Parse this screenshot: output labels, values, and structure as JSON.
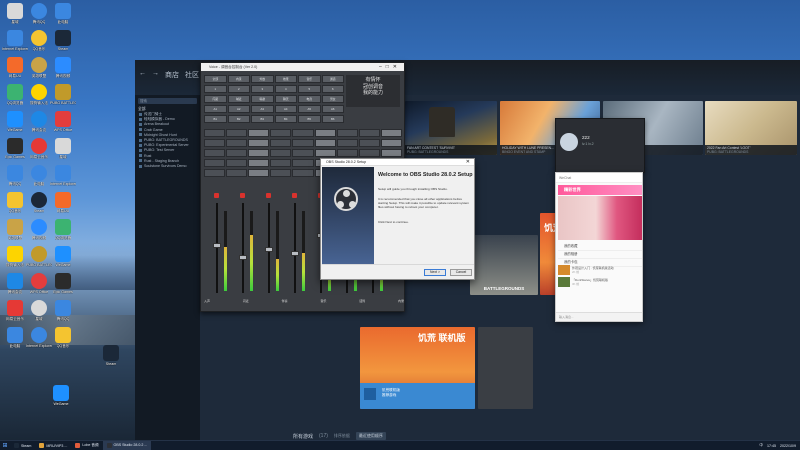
{
  "desktop": {
    "icons": [
      {
        "label": "星城",
        "color": "#d9d9d9"
      },
      {
        "label": "腾讯QQ",
        "color": "#3b87e0"
      },
      {
        "label": "此电脑",
        "color": "#3b87e0"
      },
      {
        "label": "Internet Explorer",
        "color": "#3b87e0"
      },
      {
        "label": "QQ音乐",
        "color": "#f4c430"
      },
      {
        "label": "Steam",
        "color": "#1b2838"
      },
      {
        "label": "网易UU",
        "color": "#f46a2a"
      },
      {
        "label": "英雄联盟",
        "color": "#c9a347"
      },
      {
        "label": "腾讯视频",
        "color": "#2c8cff"
      },
      {
        "label": "QQ浏览器",
        "color": "#3cb371"
      },
      {
        "label": "搜狗输入法",
        "color": "#fdd400"
      },
      {
        "label": "PUBG BATTLEGROUNDS",
        "color": "#c19a2a"
      },
      {
        "label": "WeGame",
        "color": "#1e90ff"
      },
      {
        "label": "腾讯会议",
        "color": "#1e88e5"
      },
      {
        "label": "WPS Office",
        "color": "#e33d3d"
      },
      {
        "label": "Epic Games",
        "color": "#2b2b2b"
      },
      {
        "label": "网易云音乐",
        "color": "#e53935"
      }
    ]
  },
  "steam": {
    "nav": [
      "←",
      "→",
      "商店",
      "社区"
    ],
    "side_search": "搜索",
    "side_head": "全部",
    "side_items": [
      "传送门骑士",
      "蛙蛙模拟器 - Demo",
      "Arena Breakout",
      "Crab Game",
      "Midnight Ghost Hunt",
      "PUBG: BATTLEGROUNDS",
      "PUBG: Experimental Server",
      "PUBG: Test Server",
      "Rust",
      "Rust - Staging Branch",
      "Soulstone Survivors Demo"
    ],
    "cards": [
      {
        "title": "FAN ART CONTEST 'SURVIVE'",
        "sub": "PUBG: BATTLEGROUNDS"
      },
      {
        "title": "HOLIDAY WITH LUNE PRESEN...",
        "sub": "BINGO EVENT AND STAMP"
      },
      {
        "title": "FIGHTING EVENT",
        "sub": "PUBG"
      },
      {
        "title": "2022 Fan Art Contest 'LOOT'",
        "sub": "PUBG: BATTLEGROUNDS"
      }
    ],
    "featured_game": "饥荒 联机版",
    "pubg_label": "BATTLEGROUNDS",
    "store_card": {
      "title": "饥荒联机版",
      "sub": "推荐游戏"
    },
    "library_label": "所有游戏",
    "library_count": "(17)",
    "sort_label": "排序依据",
    "sort_value": "最近使用顺序"
  },
  "mixer": {
    "title": "Voice - 调音台控制台 (Ver 2.0)",
    "rows": [
      [
        "全部",
        "内录",
        "外放",
        "效果",
        "音乐",
        "通道"
      ],
      [
        "1",
        "2",
        "3",
        "4",
        "5",
        "6"
      ],
      [
        "闪避",
        "喊麦",
        "唱歌",
        "聊天",
        "电音",
        "男女"
      ],
      [
        "A1",
        "A2",
        "A3",
        "A4",
        "A5",
        "A6"
      ],
      [
        "B1",
        "B2",
        "B3",
        "B4",
        "B5",
        "B6"
      ]
    ],
    "preset": [
      "有情怀",
      "冠创调音",
      "我的能力"
    ],
    "channels": [
      "入声",
      "闪麦",
      "伴奏",
      "音乐",
      "话筒",
      "内录"
    ]
  },
  "obs": {
    "window_title": "OBS Studio 28.0.2 Setup",
    "heading": "Welcome to OBS Studio 28.0.2 Setup",
    "p1": "Setup will guide you through installing OBS Studio.",
    "p2": "It is recommended that you close all other applications before starting Setup. This will make it possible to update relevant system files without having to reboot your computer.",
    "p3": "Click Next to continue.",
    "next_label": "Next >",
    "cancel_label": "Cancel"
  },
  "stream_panel": {
    "name": "222",
    "sub": "lv.1 lv.2"
  },
  "chat": {
    "header": "WeChat",
    "banner": "精彩世界",
    "menu": [
      "我的收藏",
      "我的相册",
      "我的卡包",
      "表情"
    ],
    "feed": [
      {
        "text": "外观设计入门 · 饥荒联机版活动",
        "meta": "2h 前"
      },
      {
        "text": "「DontStarve」饥荒联机版",
        "meta": "3h 前"
      }
    ],
    "footer": "输入消息..."
  },
  "taskbar": {
    "items": [
      {
        "label": "Steam",
        "color": "#1b2838"
      },
      {
        "label": "MRU/VIP3 ...",
        "color": "#e1a33b"
      },
      {
        "label": "Lobe 音频",
        "color": "#e25c3c"
      },
      {
        "label": "OBS Studio 28.0.2 ...",
        "color": "#2c2f36"
      }
    ],
    "ime": "中",
    "time": "17:45",
    "date": "2022/10/9"
  }
}
